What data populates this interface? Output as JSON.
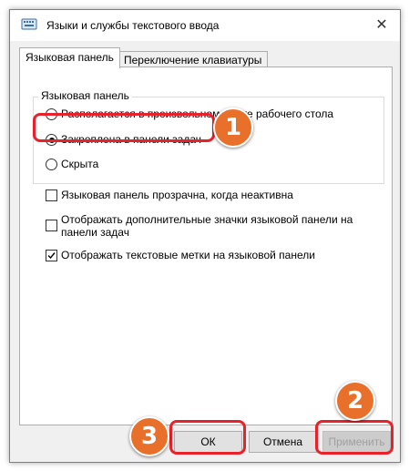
{
  "window": {
    "title": "Языки и службы текстового ввода",
    "close_glyph": "✕"
  },
  "tabs": [
    {
      "label": "Языковая панель",
      "active": true
    },
    {
      "label": "Переключение клавиатуры",
      "active": false
    }
  ],
  "language_bar": {
    "group_label": "Языковая панель",
    "options": [
      {
        "label": "Располагается в произвольном месте рабочего стола",
        "checked": false
      },
      {
        "label": "Закреплена в панели задач",
        "checked": true
      },
      {
        "label": "Скрыта",
        "checked": false
      }
    ]
  },
  "checkboxes": [
    {
      "label": "Языковая панель прозрачна, когда неактивна",
      "checked": false
    },
    {
      "label_line1": "Отображать дополнительные значки языковой панели на",
      "label_line2": "панели задач",
      "checked": false
    },
    {
      "label": "Отображать текстовые метки на языковой панели",
      "checked": true
    }
  ],
  "buttons": {
    "ok": "ОК",
    "cancel": "Отмена",
    "apply": "Применить"
  },
  "annotations": {
    "step1": "1",
    "step2": "2",
    "step3": "3",
    "color": "#e8212b",
    "badge_color": "#e8702a"
  }
}
